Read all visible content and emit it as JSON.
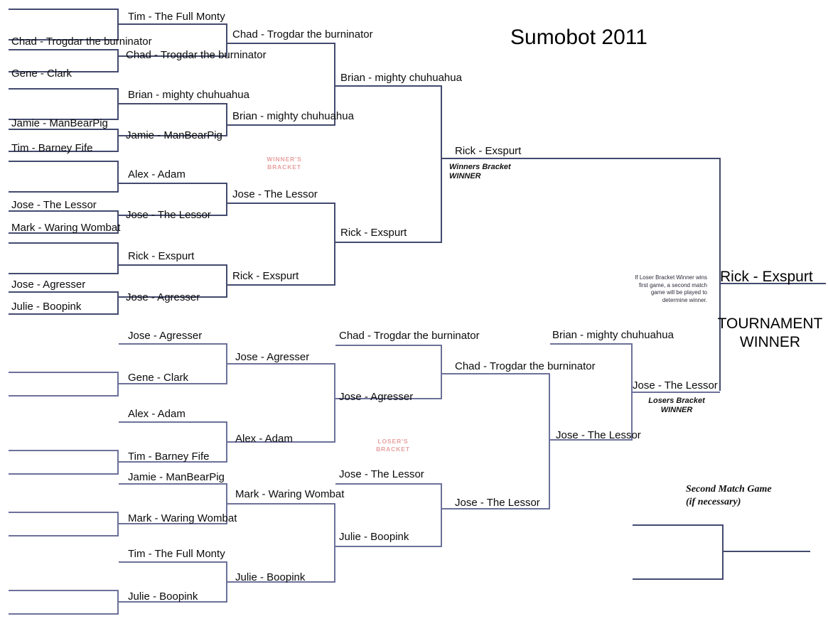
{
  "title": "Sumobot 2011",
  "labels": {
    "winners_bracket_tag": "WINNER'S\nBRACKET",
    "losers_bracket_tag": "LOSER'S\nBRACKET",
    "winners_bracket_winner": "Winners Bracket\nWINNER",
    "losers_bracket_winner": "Losers Bracket\nWINNER",
    "tournament_winner_label": "TOURNAMENT\nWINNER",
    "second_match_game": "Second Match Game\n(if necessary)",
    "tiebreak_note": "If Loser Bracket Winner wins first game, a second match game will be played to determine winner."
  },
  "champion": "Rick - Exspurt",
  "colors": {
    "line": "#434a6e",
    "line_light": "#6c719a",
    "bracket_tag": "#e8a0a0",
    "text": "#0b0b0b"
  },
  "winners_bracket": {
    "round1": [
      {
        "top": "",
        "bottom": "Chad - Trogdar the burninator",
        "seed_b": "Gene - Clark"
      },
      {
        "top": "",
        "bottom": "Jamie - ManBearPig",
        "seed_b": "Tim - Barney Fife"
      },
      {
        "top": "",
        "bottom": "Jose - The Lessor",
        "seed_b": "Mark - Waring Wombat"
      },
      {
        "top": "",
        "bottom": "Jose - Agresser",
        "seed_b": "Julie - Boopink"
      }
    ],
    "round2": [
      "Tim - The Full Monty",
      "Chad - Trogdar the burninator",
      "Brian - mighty chuhuahua",
      "Jamie - ManBearPig",
      "Alex - Adam",
      "Jose - The Lessor",
      "Rick - Exspurt",
      "Jose - Agresser"
    ],
    "round3": [
      "Chad - Trogdar the burninator",
      "Brian - mighty chuhuahua",
      "Jose - The Lessor",
      "Rick - Exspurt"
    ],
    "round4": [
      "Brian - mighty chuhuahua",
      "Rick - Exspurt"
    ],
    "final": "Rick - Exspurt"
  },
  "losers_bracket": {
    "round1": [
      "Jose - Agresser",
      "Gene - Clark",
      "Alex - Adam",
      "Tim - Barney Fife",
      "Jamie - ManBearPig",
      "Mark - Waring Wombat",
      "Tim - The Full Monty",
      "Julie - Boopink"
    ],
    "round2": [
      "Jose - Agresser",
      "Alex - Adam",
      "Mark - Waring Wombat",
      "Julie - Boopink"
    ],
    "round3": [
      "Chad - Trogdar the burninator",
      "Jose - Agresser",
      "Jose - The Lessor",
      "Julie - Boopink"
    ],
    "round4": [
      "Chad - Trogdar the burninator",
      "Jose - The Lessor"
    ],
    "round5": [
      "Brian - mighty chuhuahua",
      "Jose - The Lessor"
    ],
    "final": "Jose - The Lessor"
  }
}
